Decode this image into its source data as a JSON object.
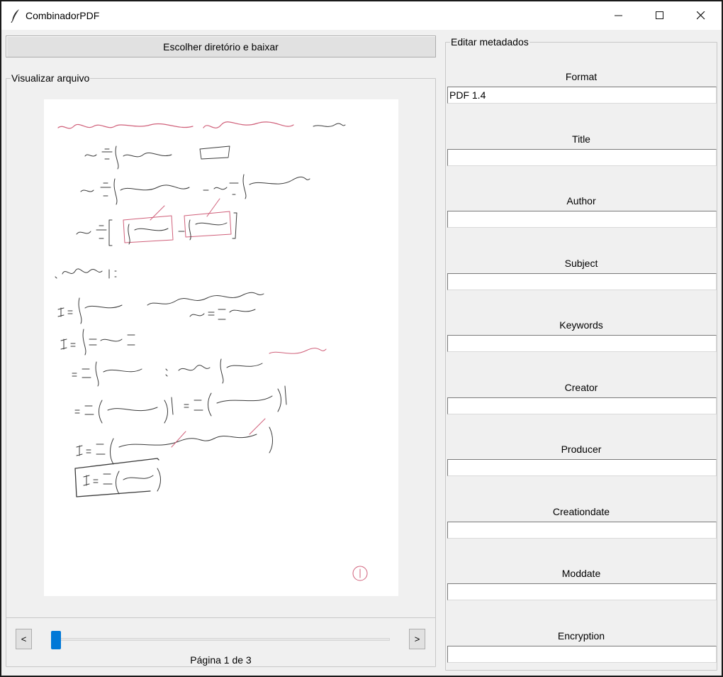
{
  "window": {
    "title": "CombinadorPDF",
    "minimize": "—",
    "maximize": "☐",
    "close": "✕"
  },
  "actions": {
    "choose_dir_label": "Escolher diretório e baixar"
  },
  "preview": {
    "group_title": "Visualizar arquivo",
    "prev_label": "<",
    "next_label": ">",
    "page_indicator": "Página 1 de 3",
    "slider_value_fraction": 0.0
  },
  "metadata": {
    "group_title": "Editar metadados",
    "fields": [
      {
        "label": "Format",
        "value": "PDF 1.4"
      },
      {
        "label": "Title",
        "value": ""
      },
      {
        "label": "Author",
        "value": ""
      },
      {
        "label": "Subject",
        "value": ""
      },
      {
        "label": "Keywords",
        "value": ""
      },
      {
        "label": "Creator",
        "value": ""
      },
      {
        "label": "Producer",
        "value": ""
      },
      {
        "label": "Creationdate",
        "value": ""
      },
      {
        "label": "Moddate",
        "value": ""
      },
      {
        "label": "Encryption",
        "value": ""
      }
    ]
  },
  "colors": {
    "accent": "#0078d7",
    "ink": "#3a3a3a",
    "red_ink": "#d0607a"
  }
}
